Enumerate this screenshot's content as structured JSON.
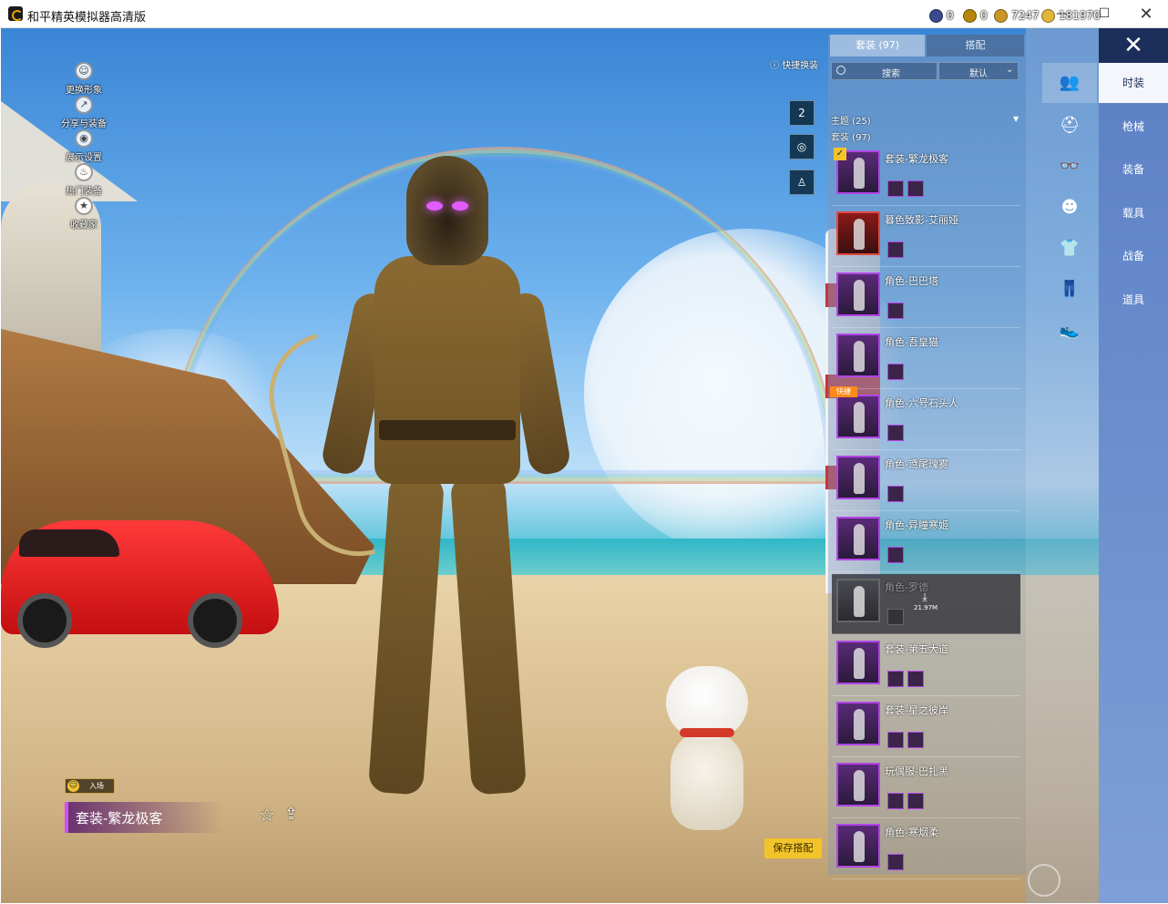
{
  "window": {
    "title": "和平精英模拟器高清版",
    "minimize_label": "—",
    "maximize_label": "☐",
    "close_label": "✕"
  },
  "left_menu": [
    {
      "label": "更换形象",
      "icon": "person-icon"
    },
    {
      "label": "分享与装备",
      "icon": "share-icon"
    },
    {
      "label": "展示设置",
      "icon": "eye-icon"
    },
    {
      "label": "热门装备",
      "icon": "fire-icon"
    },
    {
      "label": "收藏家",
      "icon": "collector-icon"
    }
  ],
  "currency": [
    {
      "value": "0",
      "color": "#3b4a8a"
    },
    {
      "value": "0",
      "color": "#b8860b"
    },
    {
      "value": "7247",
      "color": "#c9962a"
    },
    {
      "value": "181970",
      "color": "#e0b53a"
    }
  ],
  "quick_change": {
    "label": "快捷换装",
    "slot_number": "2"
  },
  "tabs": {
    "outfits": "套装 (97)",
    "match": "搭配"
  },
  "search": {
    "placeholder": "搜索",
    "sort": "默认"
  },
  "categories": {
    "theme": "主题 (25)",
    "outfits": "套装 (97)"
  },
  "outfit_items": [
    {
      "name": "套装-繁龙极客",
      "frame": "purple",
      "selected": true
    },
    {
      "name": "暮色致影-艾丽娅",
      "frame": "red"
    },
    {
      "name": "角色-巴巴塔",
      "frame": "purple"
    },
    {
      "name": "角色-吾皇猫",
      "frame": "purple"
    },
    {
      "name": "角色-六号石头人",
      "frame": "purple",
      "quick_tag": "快捷"
    },
    {
      "name": "角色-鸢尾瑰雾",
      "frame": "purple"
    },
    {
      "name": "角色-异瞳寒姬",
      "frame": "purple"
    },
    {
      "name": "角色-罗德",
      "frame": "grey",
      "download_size": "21.97M"
    },
    {
      "name": "套装-第五大道",
      "frame": "purple"
    },
    {
      "name": "套装-星之彼岸",
      "frame": "purple"
    },
    {
      "name": "玩偶服-巴扎黑",
      "frame": "purple"
    },
    {
      "name": "角色-寒烟柔",
      "frame": "purple"
    }
  ],
  "slot_icons": [
    "outfit-icon",
    "hat-icon",
    "glasses-icon",
    "hair-icon",
    "top-icon",
    "pants-icon",
    "shoes-icon"
  ],
  "right_nav": [
    {
      "label": "时装",
      "active": true
    },
    {
      "label": "枪械"
    },
    {
      "label": "装备"
    },
    {
      "label": "载具"
    },
    {
      "label": "战备"
    },
    {
      "label": "道具"
    }
  ],
  "current_outfit": {
    "badge": "入场",
    "name": "套装-繁龙极客"
  },
  "save_button": "保存搭配"
}
